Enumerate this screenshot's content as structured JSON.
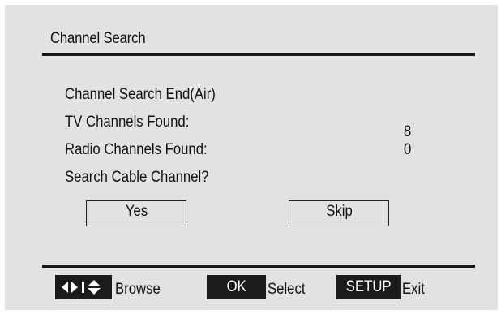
{
  "dialog": {
    "title": "Channel Search",
    "status_line": "Channel Search End(Air)",
    "tv_label": "TV Channels Found:",
    "tv_count": "8",
    "radio_label": "Radio Channels Found:",
    "radio_count": "0",
    "question": "Search Cable Channel?",
    "yes_label": "Yes",
    "skip_label": "Skip"
  },
  "footer": {
    "browse_label": "Browse",
    "ok_key": "OK",
    "select_label": "Select",
    "setup_key": "SETUP",
    "exit_label": "Exit"
  },
  "colors": {
    "background": "#e2e2e2",
    "bar": "#1a1a1a",
    "text": "#111111"
  }
}
